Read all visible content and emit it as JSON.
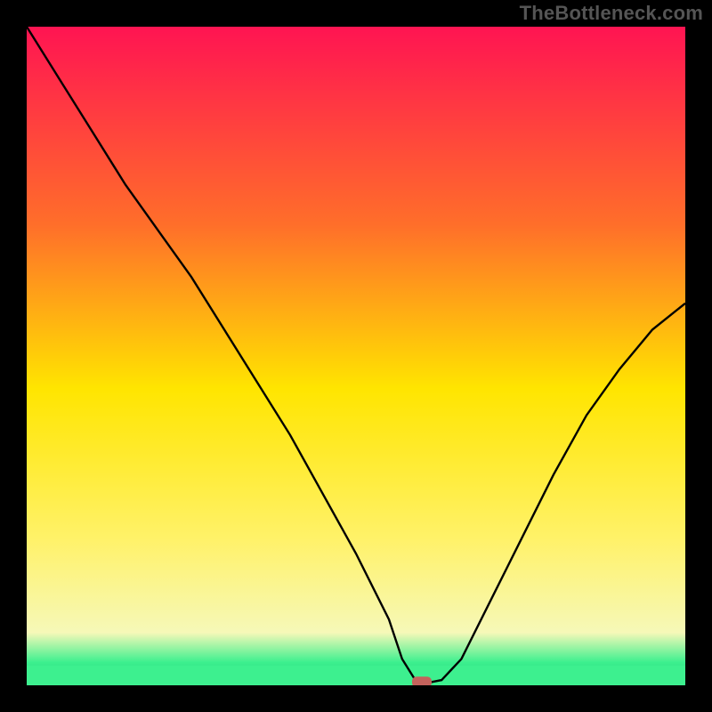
{
  "watermark": "TheBottleneck.com",
  "chart_data": {
    "type": "line",
    "title": "",
    "xlabel": "",
    "ylabel": "",
    "xlim": [
      0,
      100
    ],
    "ylim": [
      0,
      100
    ],
    "gradient_colors": {
      "top": "#FF1452",
      "upper_mid": "#FF8A2A",
      "mid": "#FFE500",
      "lower": "#F7FA9C",
      "bottom_band": "#3DF08F",
      "bottom_edge": "#17C96F"
    },
    "series": [
      {
        "name": "bottleneck-curve",
        "x": [
          0,
          5,
          10,
          15,
          20,
          25,
          30,
          35,
          40,
          45,
          50,
          55,
          57,
          59,
          61,
          63,
          66,
          70,
          75,
          80,
          85,
          90,
          95,
          100
        ],
        "y": [
          100,
          92,
          84,
          76,
          69,
          62,
          54,
          46,
          38,
          29,
          20,
          10,
          4,
          0.8,
          0.4,
          0.8,
          4,
          12,
          22,
          32,
          41,
          48,
          54,
          58
        ]
      }
    ],
    "marker": {
      "x": 60,
      "y": 0.5,
      "color": "#C4625C"
    },
    "bottom_strip_y": 3
  }
}
